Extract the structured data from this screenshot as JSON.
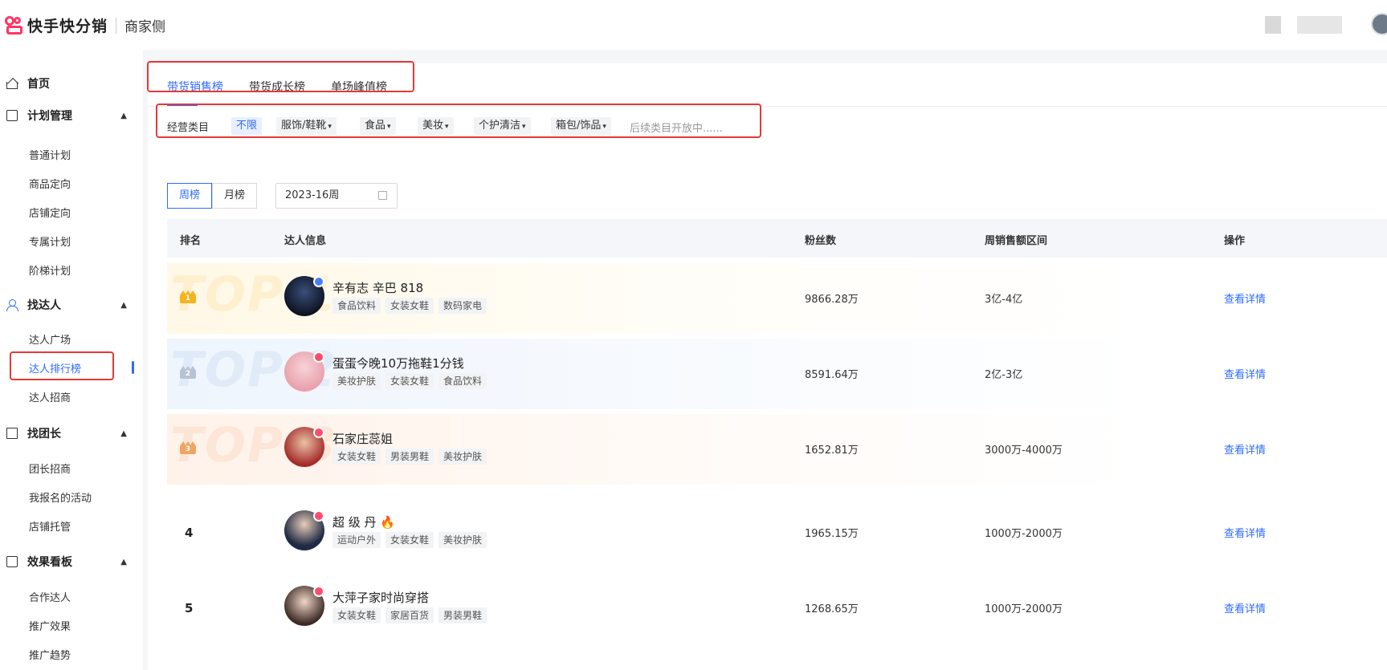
{
  "header": {
    "brand": "快手快分销",
    "sub": "商家侧"
  },
  "sidebar": {
    "home": "首页",
    "groups": [
      {
        "title": "计划管理",
        "items": [
          "普通计划",
          "商品定向",
          "店铺定向",
          "专属计划",
          "阶梯计划"
        ]
      },
      {
        "title": "找达人",
        "items": [
          "达人广场",
          "达人排行榜",
          "达人招商"
        ]
      },
      {
        "title": "找团长",
        "items": [
          "团长招商",
          "我报名的活动",
          "店铺托管"
        ]
      },
      {
        "title": "效果看板",
        "items": [
          "合作达人",
          "推广效果",
          "推广趋势"
        ]
      }
    ],
    "active_item": "达人排行榜"
  },
  "tabs": [
    "带货销售榜",
    "带货成长榜",
    "单场峰值榜"
  ],
  "filter": {
    "label": "经营类目",
    "chips": [
      "不限",
      "服饰/鞋靴",
      "食品",
      "美妆",
      "个护清洁",
      "箱包/饰品"
    ],
    "note": "后续类目开放中......"
  },
  "period": {
    "buttons": [
      "周榜",
      "月榜"
    ],
    "date": "2023-16周"
  },
  "table": {
    "headers": [
      "排名",
      "达人信息",
      "粉丝数",
      "周销售额区间",
      "操作"
    ],
    "watermarks": [
      "TOP 1",
      "TOP 2",
      "TOP 3"
    ],
    "rows": [
      {
        "rank": "1",
        "name": "辛有志 辛巴 818",
        "tags": [
          "食品饮料",
          "女装女鞋",
          "数码家电"
        ],
        "fans": "9866.28万",
        "sales": "3亿-4亿",
        "op": "查看详情"
      },
      {
        "rank": "2",
        "name": "蛋蛋今晚10万拖鞋1分钱",
        "tags": [
          "美妆护肤",
          "女装女鞋",
          "食品饮料"
        ],
        "fans": "8591.64万",
        "sales": "2亿-3亿",
        "op": "查看详情"
      },
      {
        "rank": "3",
        "name": "石家庄蕊姐",
        "tags": [
          "女装女鞋",
          "男装男鞋",
          "美妆护肤"
        ],
        "fans": "1652.81万",
        "sales": "3000万-4000万",
        "op": "查看详情"
      },
      {
        "rank": "4",
        "name": "超 级 丹 🔥",
        "tags": [
          "运动户外",
          "女装女鞋",
          "美妆护肤"
        ],
        "fans": "1965.15万",
        "sales": "1000万-2000万",
        "op": "查看详情"
      },
      {
        "rank": "5",
        "name": "大萍子家时尚穿搭",
        "tags": [
          "女装女鞋",
          "家居百货",
          "男装男鞋"
        ],
        "fans": "1268.65万",
        "sales": "1000万-2000万",
        "op": "查看详情"
      }
    ]
  },
  "colors": {
    "accent": "#2f6bff",
    "highlight": "#e53935",
    "brand": "#fe3666"
  }
}
